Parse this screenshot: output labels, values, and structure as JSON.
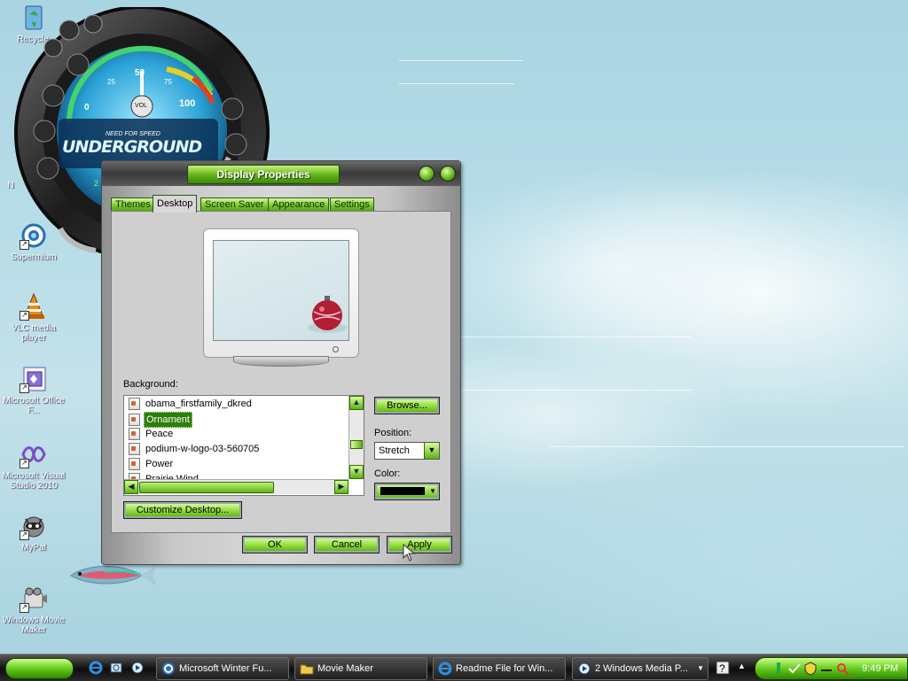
{
  "desktop": {
    "icons": [
      {
        "label": "Recycle",
        "icon": "recycle-bin-icon"
      },
      {
        "label": "Supermium",
        "icon": "supermium-browser-icon"
      },
      {
        "label": "VLC media player",
        "icon": "vlc-cone-icon"
      },
      {
        "label": "Microsoft Office F...",
        "icon": "office-icon"
      },
      {
        "label": "Microsoft Visual Studio 2010",
        "icon": "visual-studio-icon"
      },
      {
        "label": "MyPal",
        "icon": "mypal-raccoon-icon"
      },
      {
        "label": "Windows Movie Maker",
        "icon": "movie-maker-icon"
      }
    ],
    "partial_label": "N"
  },
  "gadget": {
    "scale": [
      "0",
      "25",
      "50",
      "75",
      "100"
    ],
    "knob_label": "VOL",
    "logo_small": "NEED FOR SPEED",
    "logo": "UNDERGROUND",
    "side_ticks": [
      "2"
    ]
  },
  "dialog": {
    "title": "Display Properties",
    "tabs": [
      "Themes",
      "Desktop",
      "Screen Saver",
      "Appearance",
      "Settings"
    ],
    "selected_tab": "Desktop",
    "background_label": "Background:",
    "backgrounds": [
      "obama_firstfamily_dkred",
      "Ornament",
      "Peace",
      "podium-w-logo-03-560705",
      "Power",
      "Prairie Wind"
    ],
    "selected_background": "Ornament",
    "browse_label": "Browse...",
    "position_label": "Position:",
    "position_value": "Stretch",
    "color_label": "Color:",
    "color_value": "#000000",
    "customize_label": "Customize Desktop...",
    "ok_label": "OK",
    "cancel_label": "Cancel",
    "apply_label": "Apply"
  },
  "taskbar": {
    "tasks": [
      {
        "label": "Microsoft Winter Fu...",
        "icon": "supermium-icon"
      },
      {
        "label": "Movie Maker",
        "icon": "folder-icon"
      },
      {
        "label": "Readme File for Win...",
        "icon": "internet-explorer-icon"
      },
      {
        "label": "2 Windows Media P...",
        "icon": "media-player-icon"
      }
    ],
    "clock": "9:49 PM",
    "colors": {
      "accent": "#5fb116",
      "taskbar": "#1b1b1b"
    }
  }
}
